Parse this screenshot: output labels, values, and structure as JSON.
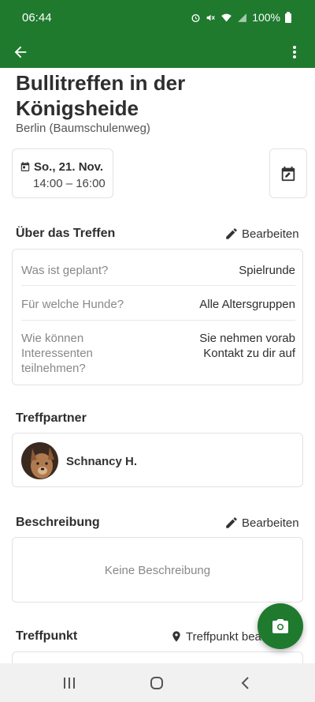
{
  "status_bar": {
    "time": "06:44",
    "battery": "100%"
  },
  "app_bar": {
    "back_icon": "arrow-left-icon",
    "menu_icon": "more-vert-icon"
  },
  "event": {
    "title": "Bullitreffen in der Königsheide",
    "location": "Berlin (Baumschulenweg)",
    "date": "So., 21. Nov.",
    "time": "14:00 – 16:00"
  },
  "about": {
    "heading": "Über das Treffen",
    "edit_label": "Bearbeiten",
    "rows": [
      {
        "label": "Was ist geplant?",
        "value": "Spielrunde"
      },
      {
        "label": "Für welche Hunde?",
        "value": "Alle Altersgruppen"
      },
      {
        "label": "Wie können Interessenten teilnehmen?",
        "value": "Sie nehmen vorab Kontakt zu dir auf"
      }
    ]
  },
  "partner": {
    "heading": "Treffpartner",
    "name": "Schnancy H."
  },
  "description": {
    "heading": "Beschreibung",
    "edit_label": "Bearbeiten",
    "empty_text": "Keine Beschreibung"
  },
  "meeting_point": {
    "heading": "Treffpunkt",
    "edit_label": "Treffpunkt bea"
  },
  "colors": {
    "primary": "#1f7a2e",
    "border": "#e2e2e2",
    "muted_text": "#888888"
  }
}
